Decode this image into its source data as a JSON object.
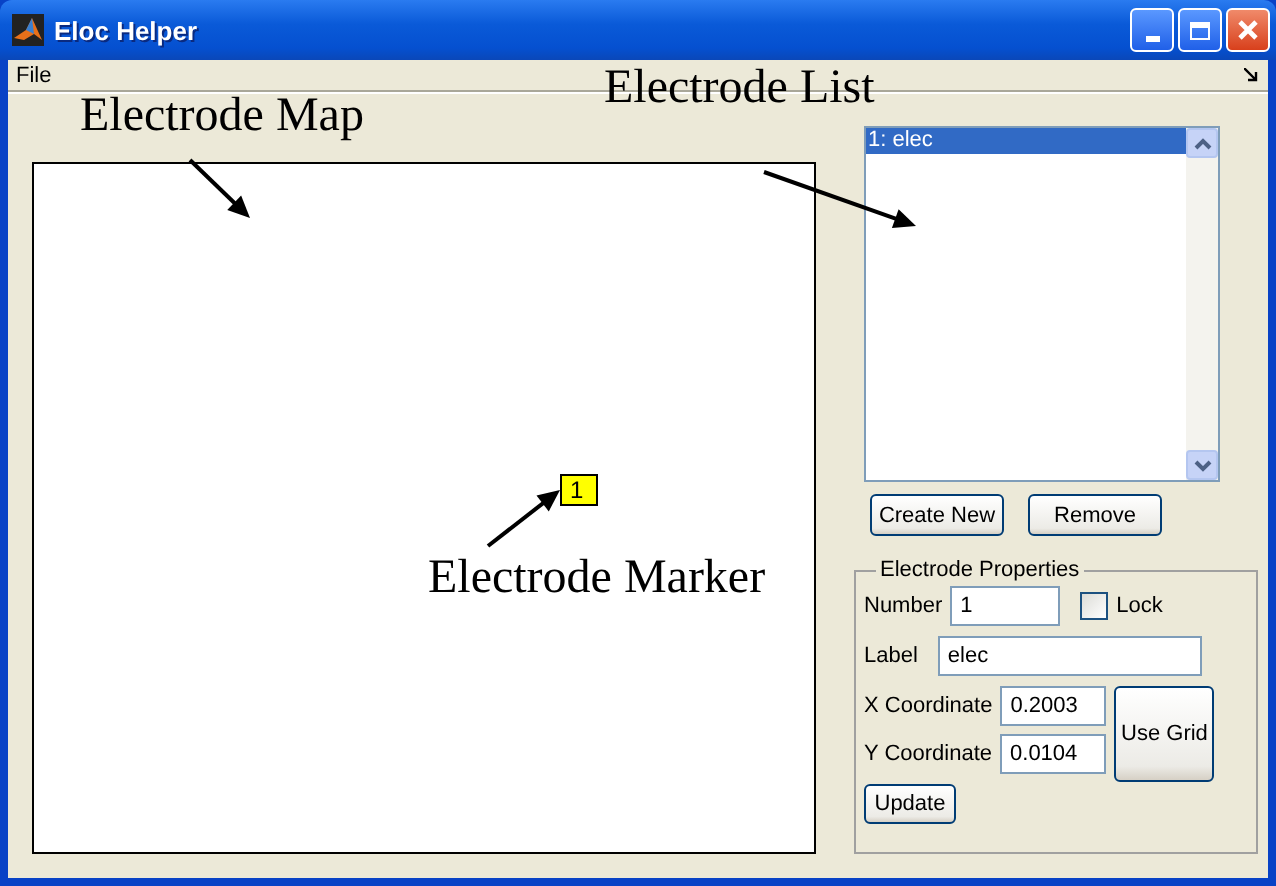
{
  "window": {
    "title": "Eloc Helper"
  },
  "menu": [
    "File"
  ],
  "annotations": [
    {
      "text": "Electrode Map",
      "kind": "map"
    },
    {
      "text": "Electrode List",
      "kind": "list"
    },
    {
      "text": "Electrode Marker",
      "kind": "marker"
    }
  ],
  "map": {
    "marker": "1"
  },
  "list": {
    "items": [
      {
        "label": "1: elec",
        "selected": true
      }
    ]
  },
  "list_buttons": [
    "Create New",
    "Remove"
  ],
  "properties": {
    "title": "Electrode Properties",
    "number": {
      "label": "Number",
      "value": "1"
    },
    "lock": {
      "label": "Lock",
      "checked": false
    },
    "label": {
      "label": "Label",
      "value": "elec"
    },
    "x": {
      "label": "X Coordinate",
      "value": "0.2003"
    },
    "y": {
      "label": "Y Coordinate",
      "value": "0.0104"
    },
    "grid_button": "Use Grid",
    "update_button": "Update"
  }
}
